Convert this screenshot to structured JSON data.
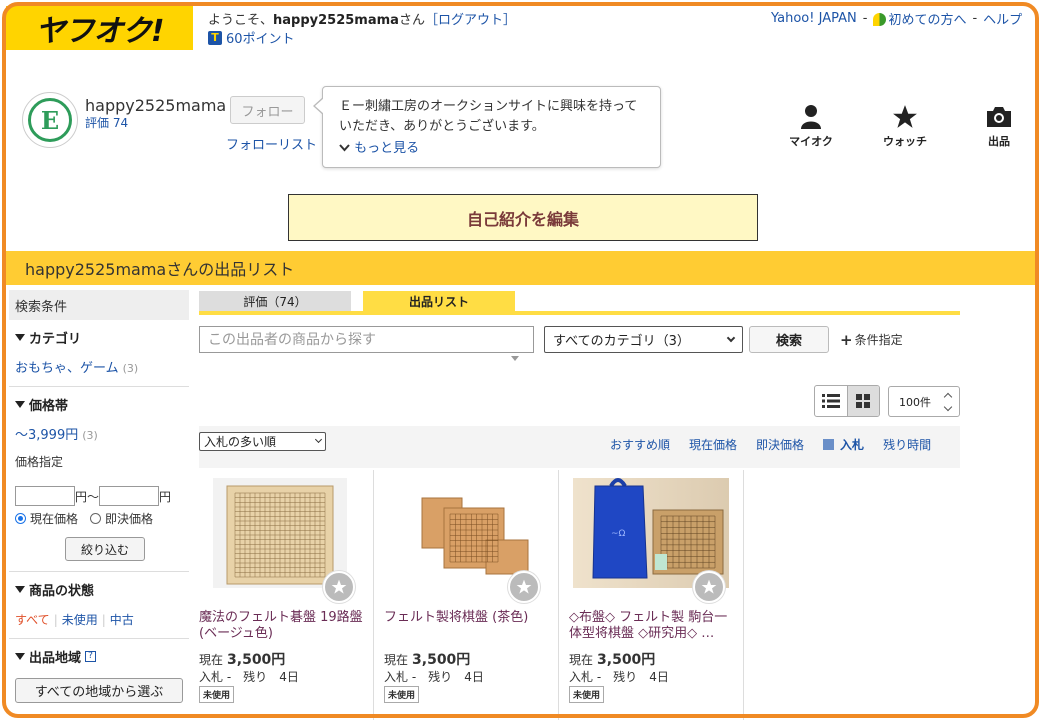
{
  "header": {
    "logo": "ヤフオク!",
    "welcome_prefix": "ようこそ、",
    "welcome_user": "happy2525mama",
    "welcome_suffix": "さん",
    "logout": "［ログアウト］",
    "points": "60ポイント",
    "points_icon": "T",
    "links": [
      "Yahoo! JAPAN",
      "初めての方へ",
      "ヘルプ"
    ]
  },
  "profile": {
    "avatar_letter": "E",
    "name": "happy2525mama",
    "evaluation": "評価 74",
    "follow_button": "フォロー",
    "follow_list": "フォローリスト",
    "intro": "Ｅー刺繡工房のオークションサイトに興味を持っていただき、ありがとうございます。",
    "more": "もっと見る"
  },
  "header_icons": [
    {
      "label": "マイオク",
      "icon": "person-icon"
    },
    {
      "label": "ウォッチ",
      "icon": "star-icon"
    },
    {
      "label": "出品",
      "icon": "camera-icon"
    }
  ],
  "edit_intro_button": "自己紹介を編集",
  "banner_title": "happy2525mamaさんの出品リスト",
  "sidebar": {
    "heading": "検索条件",
    "category": {
      "title": "カテゴリ",
      "link": "おもちゃ、ゲーム",
      "count": "(3)"
    },
    "price": {
      "title": "価格帯",
      "link": "～3,999円",
      "count": "(3)",
      "specify": "価格指定",
      "unit_from": "円～",
      "unit_to": "円",
      "radio_current": "現在価格",
      "radio_buynow": "即決価格",
      "narrow_button": "絞り込む"
    },
    "condition": {
      "title": "商品の状態",
      "all": "すべて",
      "unused": "未使用",
      "used": "中古"
    },
    "region": {
      "title": "出品地域",
      "help": "?",
      "button": "すべての地域から選ぶ"
    }
  },
  "tabs": [
    {
      "label": "評価（74）"
    },
    {
      "label": "出品リスト"
    }
  ],
  "search": {
    "placeholder": "この出品者の商品から探す",
    "category_select": "すべてのカテゴリ（3）",
    "button": "検索",
    "condition": "条件指定"
  },
  "per_page": "100件",
  "sort": {
    "select": "入札の多い順",
    "links": [
      "おすすめ順",
      "現在価格",
      "即決価格",
      "入札",
      "残り時間"
    ],
    "active_index": 3
  },
  "products": [
    {
      "title": "魔法のフェルト碁盤 19路盤 (ベージュ色)",
      "price_label": "現在",
      "price": "3,500円",
      "bids": "入札 -",
      "remaining": "残り",
      "remaining_value": "4日",
      "badge": "未使用"
    },
    {
      "title": "フェルト製将棋盤 (茶色)",
      "price_label": "現在",
      "price": "3,500円",
      "bids": "入札 -",
      "remaining": "残り",
      "remaining_value": "4日",
      "badge": "未使用"
    },
    {
      "title": "◇布盤◇ フェルト製 駒台一体型将棋盤 ◇研究用◇ …",
      "price_label": "現在",
      "price": "3,500円",
      "bids": "入札 -",
      "remaining": "残り",
      "remaining_value": "4日",
      "badge": "未使用"
    }
  ],
  "colors": {
    "accent_yellow": "#ffd400",
    "banner": "#ffcc33",
    "frame_orange": "#f08a24",
    "link_blue": "#1d54a7",
    "product_title": "#6a2c55"
  }
}
